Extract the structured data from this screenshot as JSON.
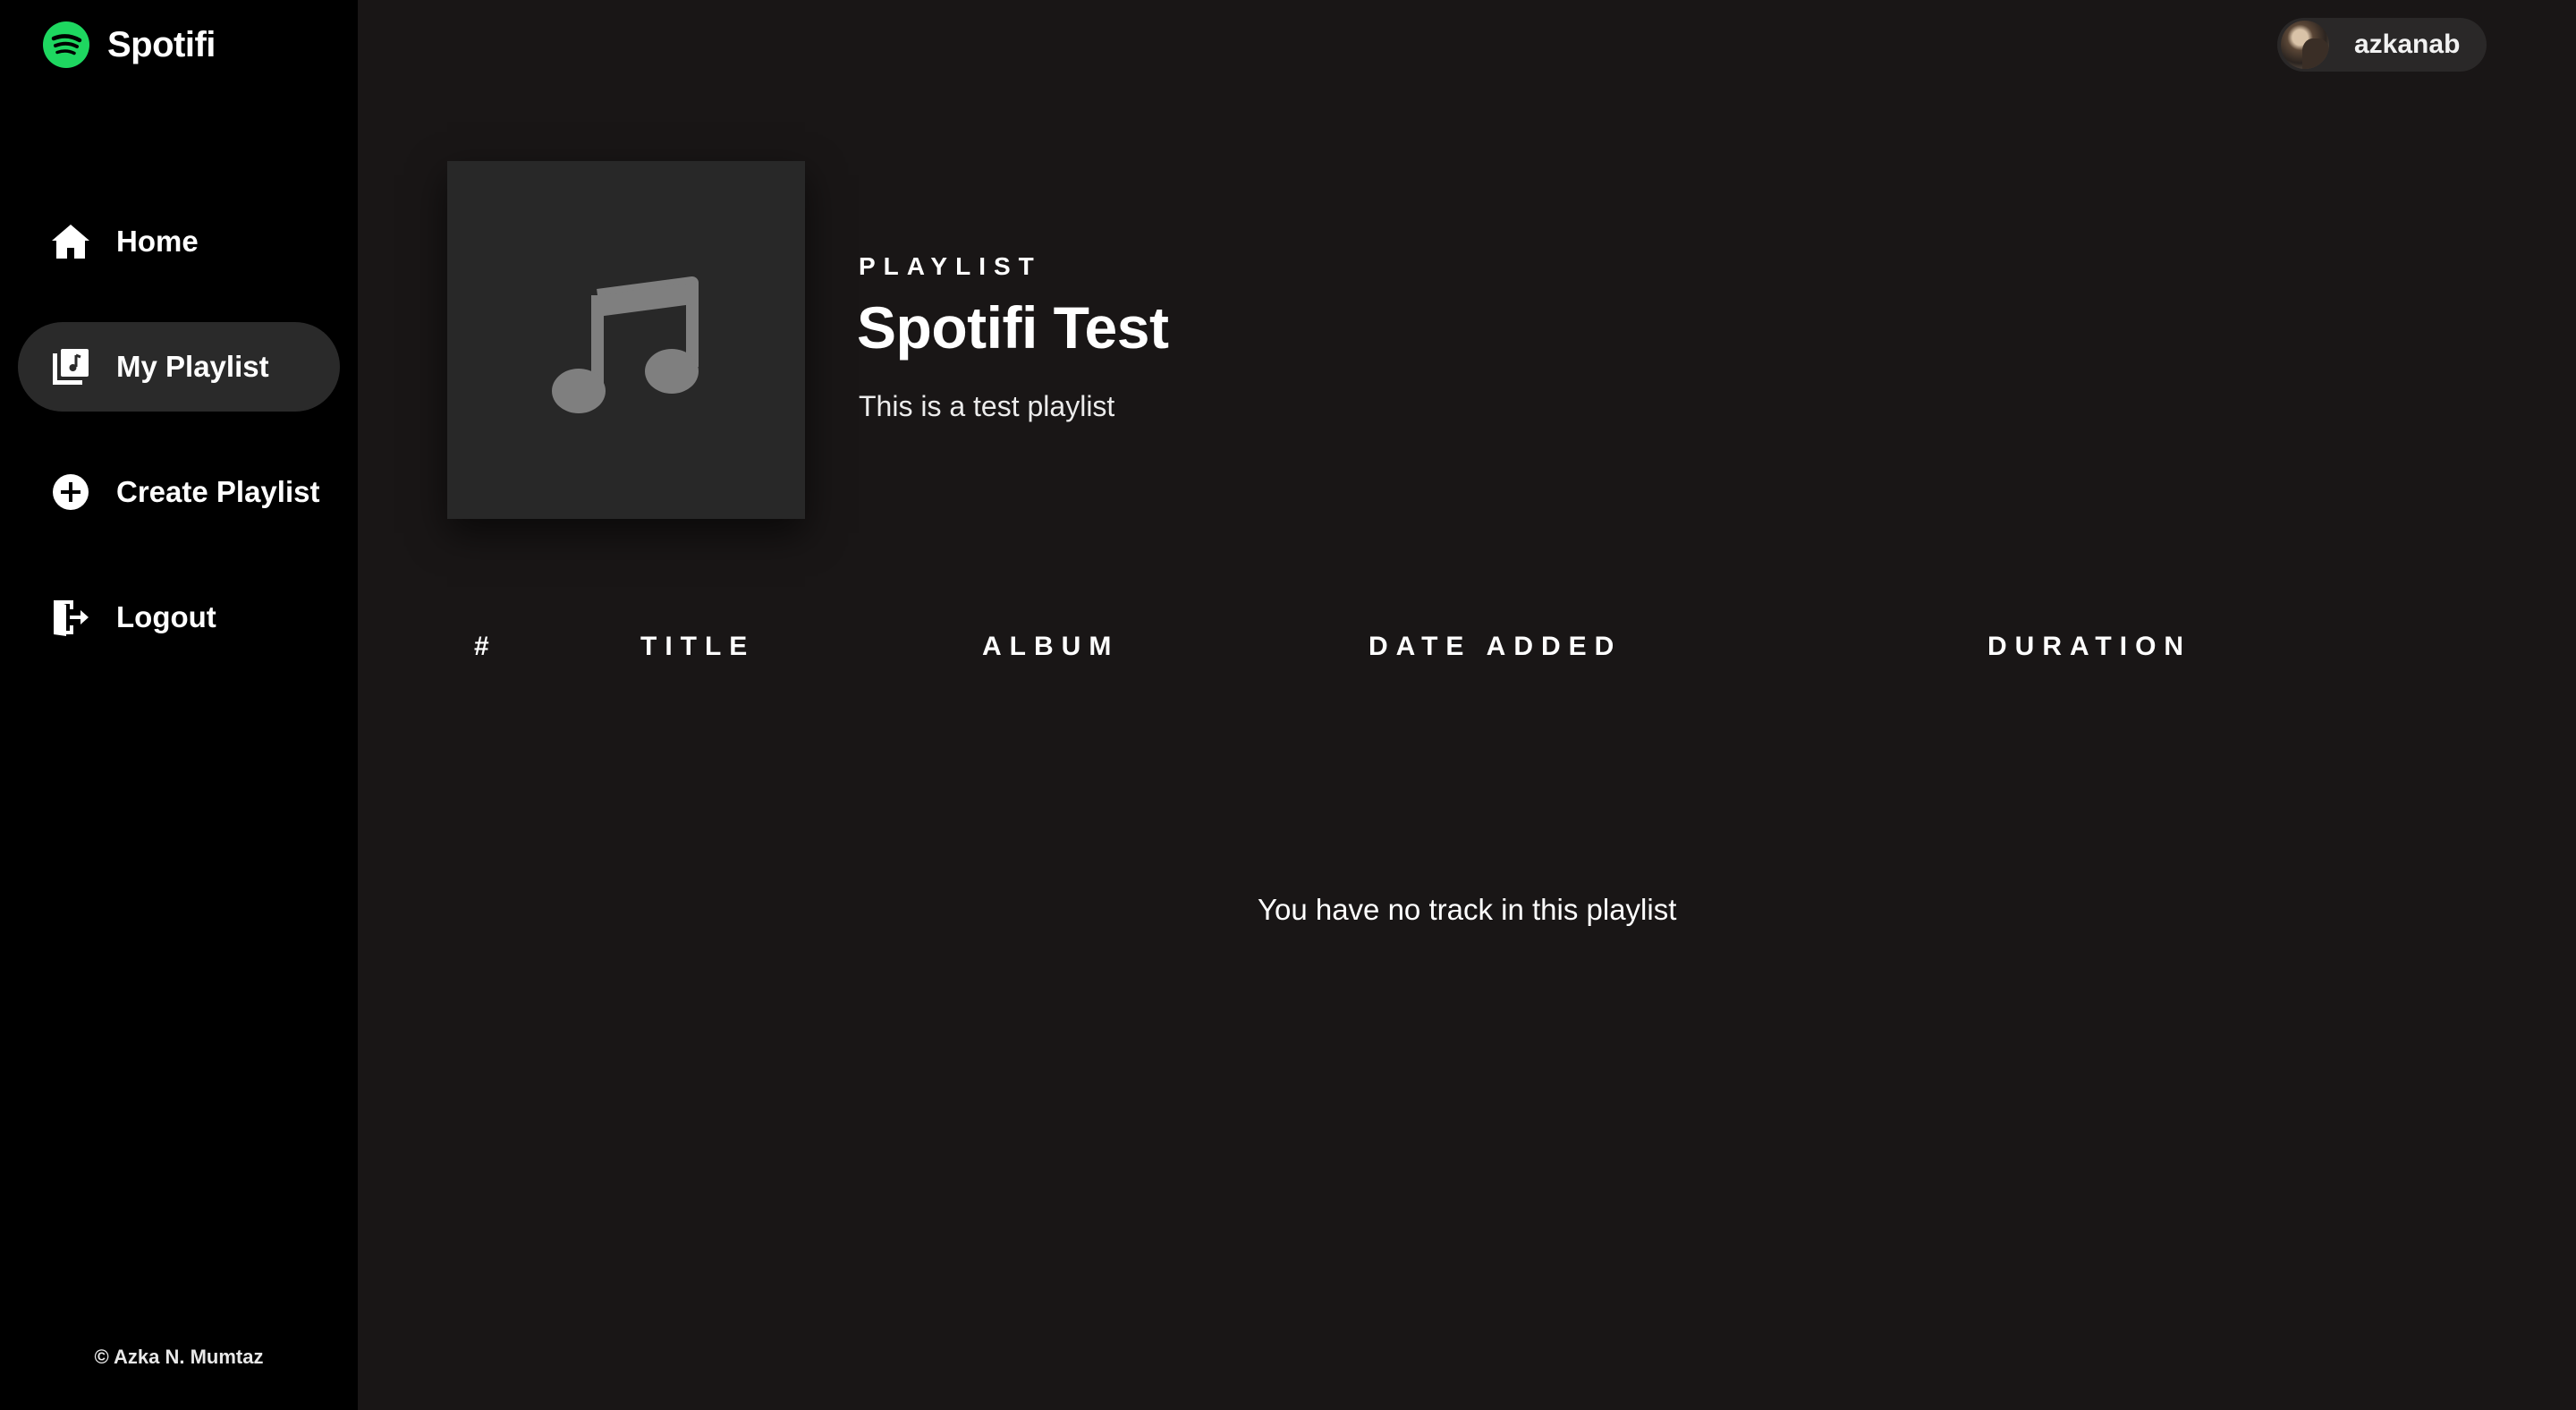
{
  "brand": {
    "name": "Spotifi",
    "logo_icon": "spotify-logo-icon",
    "accent": "#1ed760"
  },
  "sidebar": {
    "items": [
      {
        "label": "Home",
        "icon": "home-icon",
        "active": false
      },
      {
        "label": "My Playlist",
        "icon": "playlist-icon",
        "active": true
      },
      {
        "label": "Create Playlist",
        "icon": "plus-circle-icon",
        "active": false
      },
      {
        "label": "Logout",
        "icon": "logout-icon",
        "active": false
      }
    ],
    "footer": "© Azka N. Mumtaz"
  },
  "user": {
    "name": "azkanab",
    "avatar_icon": "avatar"
  },
  "playlist": {
    "kind": "PLAYLIST",
    "title": "Spotifi Test",
    "description": "This is a test playlist",
    "cover_icon": "music-note-icon"
  },
  "tracks_table": {
    "columns": [
      "#",
      "TITLE",
      "ALBUM",
      "DATE ADDED",
      "DURATION"
    ],
    "rows": [],
    "empty_message": "You have no track in this playlist"
  },
  "colors": {
    "sidebar_bg": "#000000",
    "main_bg": "#191616",
    "active_item_bg": "#2a2a2a",
    "cover_bg": "#282828",
    "cover_icon": "#7f7f7f"
  }
}
